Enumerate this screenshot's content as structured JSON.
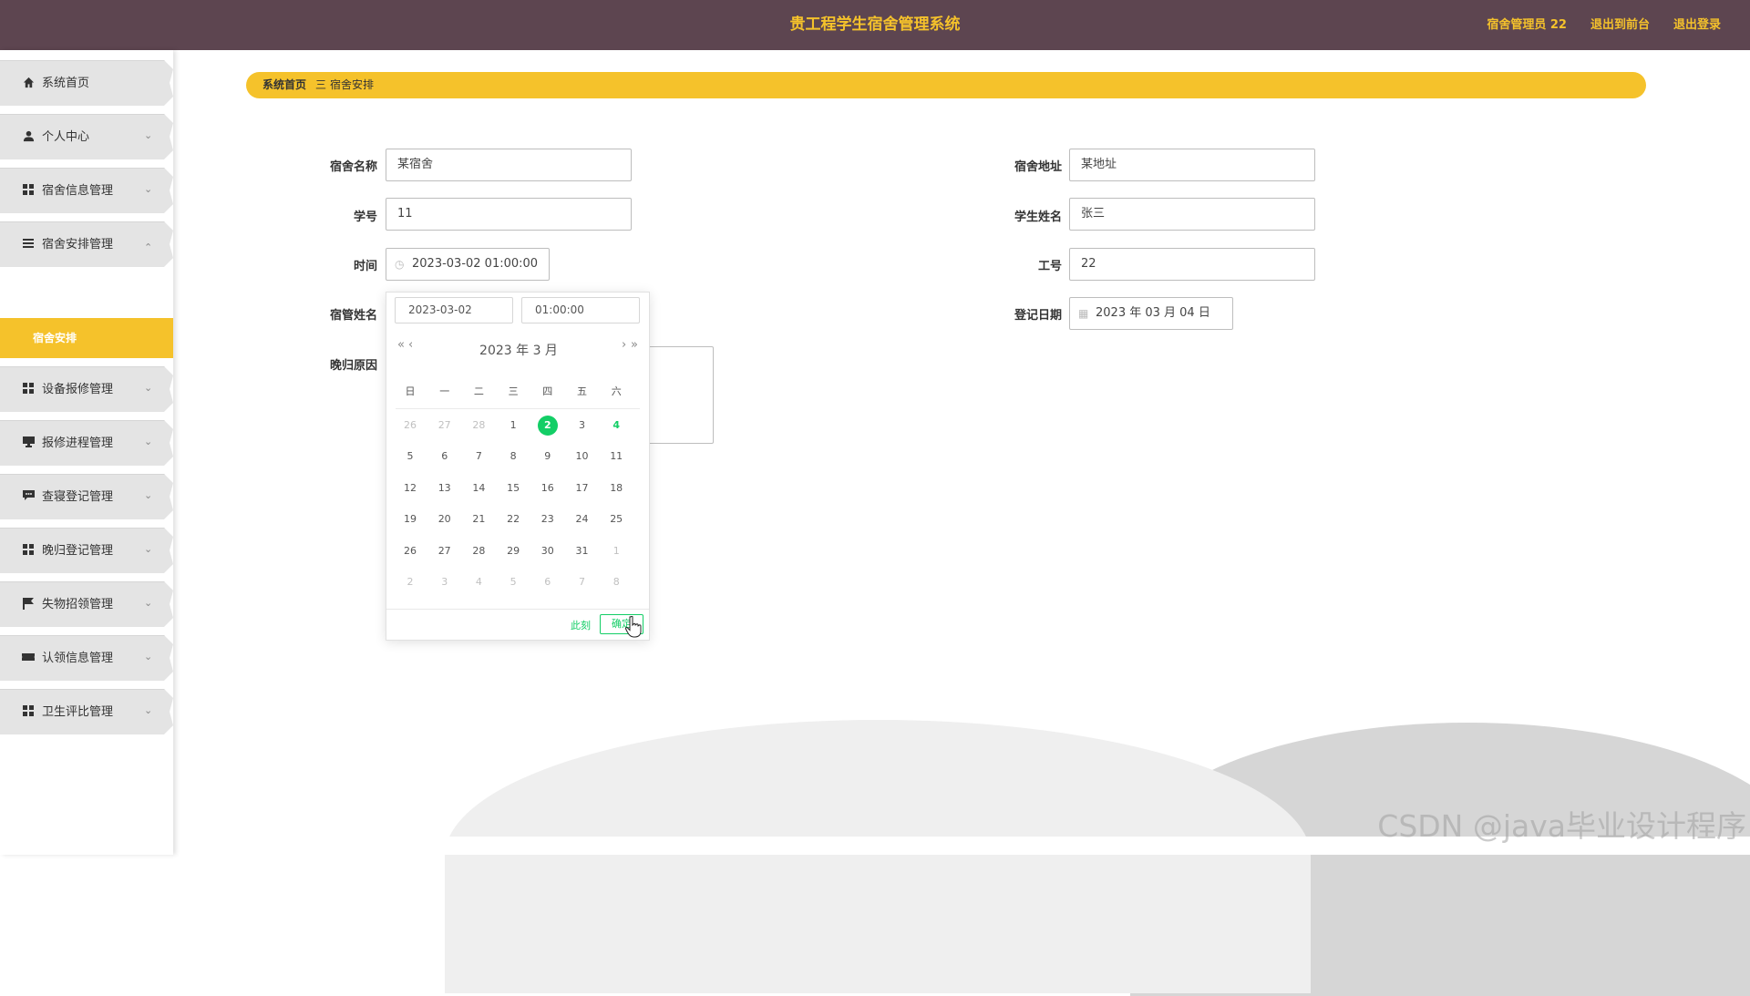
{
  "header": {
    "title": "贵工程学生宿舍管理系统",
    "user": "宿舍管理员 22",
    "front_link": "退出到前台",
    "logout_link": "退出登录"
  },
  "sidebar": {
    "items": [
      {
        "label": "系统首页",
        "icon": "home-icon"
      },
      {
        "label": "个人中心",
        "icon": "user-icon"
      },
      {
        "label": "宿舍信息管理",
        "icon": "grid-icon"
      },
      {
        "label": "宿舍安排管理",
        "icon": "list-icon"
      },
      {
        "label": "设备报修管理",
        "icon": "grid-icon"
      },
      {
        "label": "报修进程管理",
        "icon": "monitor-icon"
      },
      {
        "label": "查寝登记管理",
        "icon": "chat-icon"
      },
      {
        "label": "晚归登记管理",
        "icon": "grid-icon"
      },
      {
        "label": "失物招领管理",
        "icon": "flag-icon"
      },
      {
        "label": "认领信息管理",
        "icon": "ticket-icon"
      },
      {
        "label": "卫生评比管理",
        "icon": "grid-icon"
      }
    ],
    "sub_item": "宿舍安排"
  },
  "breadcrumb": {
    "home": "系统首页",
    "separator": "三",
    "current": "宿舍安排"
  },
  "form": {
    "dorm_name_label": "宿舍名称",
    "dorm_name_value": "某宿舍",
    "dorm_address_label": "宿舍地址",
    "dorm_address_value": "某地址",
    "student_id_label": "学号",
    "student_id_value": "11",
    "student_name_label": "学生姓名",
    "student_name_value": "张三",
    "time_label": "时间",
    "time_value": "2023-03-02 01:00:00",
    "staff_id_label": "工号",
    "staff_id_value": "22",
    "manager_name_label": "宿管姓名",
    "register_date_label": "登记日期",
    "register_date_value": "2023 年 03 月 04 日",
    "late_reason_label": "晚归原因"
  },
  "picker": {
    "date_input": "2023-03-02",
    "time_input": "01:00:00",
    "prev_year": "«",
    "prev_month": "‹",
    "next_month": "›",
    "next_year": "»",
    "header": "2023 年  3 月",
    "weekdays": [
      "日",
      "一",
      "二",
      "三",
      "四",
      "五",
      "六"
    ],
    "days": [
      [
        "26",
        "27",
        "28",
        "1",
        "2",
        "3",
        "4"
      ],
      [
        "5",
        "6",
        "7",
        "8",
        "9",
        "10",
        "11"
      ],
      [
        "12",
        "13",
        "14",
        "15",
        "16",
        "17",
        "18"
      ],
      [
        "19",
        "20",
        "21",
        "22",
        "23",
        "24",
        "25"
      ],
      [
        "26",
        "27",
        "28",
        "29",
        "30",
        "31",
        "1"
      ],
      [
        "2",
        "3",
        "4",
        "5",
        "6",
        "7",
        "8"
      ]
    ],
    "selected_day": "2",
    "today_day": "4",
    "now_label": "此刻",
    "ok_label": "确定"
  },
  "watermark": "CSDN @java毕业设计程序",
  "colors": {
    "header_bg": "#5d4550",
    "accent": "#f5c22b",
    "picker_green": "#13ce66"
  }
}
